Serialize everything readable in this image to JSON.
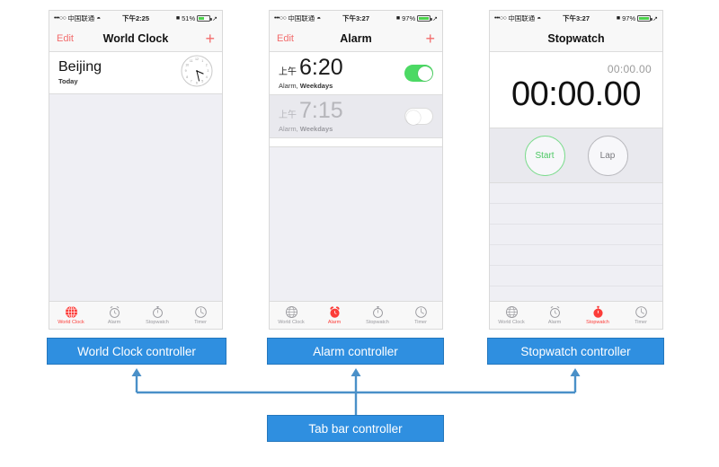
{
  "colors": {
    "accent_red": "#fc3d39",
    "toggle_green": "#4cd964",
    "callout_blue": "#2f8fe0",
    "wire_blue": "#4a90c8",
    "tint_pink": "#f26d6d"
  },
  "phones": [
    {
      "id": "world-clock",
      "status": {
        "signal_dots": "•••○○",
        "carrier": "中国联通",
        "wifi_icon": "wifi-icon",
        "time": "下午2:25",
        "battery_percent": "51%",
        "battery_level": 51
      },
      "nav": {
        "left_label": "Edit",
        "title": "World Clock",
        "right_icon": "plus-icon"
      },
      "world_clock": {
        "city": "Beijing",
        "subtitle": "Today",
        "clock_icon": "analog-clock-icon"
      }
    },
    {
      "id": "alarm",
      "status": {
        "signal_dots": "•••○○",
        "carrier": "中国联通",
        "wifi_icon": "wifi-icon",
        "time": "下午3:27",
        "battery_percent": "97%",
        "battery_level": 97
      },
      "nav": {
        "left_label": "Edit",
        "title": "Alarm",
        "right_icon": "plus-icon"
      },
      "alarms": [
        {
          "ampm": "上午",
          "time": "6:20",
          "label_prefix": "Alarm, ",
          "label_days": "Weekdays",
          "enabled": true
        },
        {
          "ampm": "上午",
          "time": "7:15",
          "label_prefix": "Alarm, ",
          "label_days": "Weekdays",
          "enabled": false
        }
      ]
    },
    {
      "id": "stopwatch",
      "status": {
        "signal_dots": "•••○○",
        "carrier": "中国联通",
        "wifi_icon": "wifi-icon",
        "time": "下午3:27",
        "battery_percent": "97%",
        "battery_level": 97
      },
      "nav": {
        "left_label": "",
        "title": "Stopwatch",
        "right_icon": ""
      },
      "stopwatch": {
        "lap_time": "00:00.00",
        "main_time": "00:00.00",
        "start_label": "Start",
        "lap_label": "Lap"
      }
    }
  ],
  "tab_bar": {
    "items": [
      {
        "label": "World Clock",
        "icon": "globe-icon"
      },
      {
        "label": "Alarm",
        "icon": "alarm-clock-icon"
      },
      {
        "label": "Stopwatch",
        "icon": "stopwatch-icon"
      },
      {
        "label": "Timer",
        "icon": "timer-icon"
      }
    ],
    "active_index": [
      0,
      1,
      2
    ]
  },
  "callouts": {
    "world_clock_controller": "World Clock controller",
    "alarm_controller": "Alarm controller",
    "stopwatch_controller": "Stopwatch controller",
    "tab_bar_controller": "Tab bar controller"
  }
}
